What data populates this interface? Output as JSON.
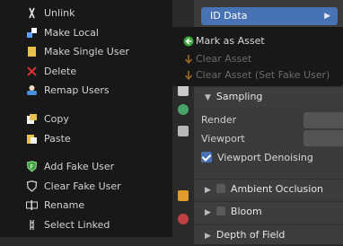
{
  "context_menu": {
    "items": [
      {
        "label": "Unlink",
        "icon": "unlink-icon"
      },
      {
        "label": "Make Local",
        "icon": "make-local-icon"
      },
      {
        "label": "Make Single User",
        "icon": "single-user-icon"
      },
      {
        "label": "Delete",
        "icon": "delete-icon"
      },
      {
        "label": "Remap Users",
        "icon": "remap-users-icon"
      },
      {
        "label": "Copy",
        "icon": "copy-icon"
      },
      {
        "label": "Paste",
        "icon": "paste-icon"
      },
      {
        "label": "Add Fake User",
        "icon": "fake-user-icon"
      },
      {
        "label": "Clear Fake User",
        "icon": "fake-user-outline-icon"
      },
      {
        "label": "Rename",
        "icon": "rename-icon"
      },
      {
        "label": "Select Linked",
        "icon": "select-linked-icon"
      }
    ]
  },
  "submenu": {
    "title": "ID Data",
    "items": [
      {
        "label": "Mark as Asset",
        "enabled": true
      },
      {
        "label": "Clear Asset",
        "enabled": false
      },
      {
        "label": "Clear Asset (Set Fake User)",
        "enabled": false
      }
    ]
  },
  "properties": {
    "sampling_title": "Sampling",
    "render_label": "Render",
    "viewport_label": "Viewport",
    "viewport_denoising_label": "Viewport Denoising",
    "viewport_denoising_checked": true,
    "ambient_occlusion_label": "Ambient Occlusion",
    "bloom_label": "Bloom",
    "depth_of_field_label": "Depth of Field"
  },
  "colors": {
    "accent": "#4772b3",
    "menu_bg": "#181818",
    "panel_bg": "#3b3b3b"
  }
}
